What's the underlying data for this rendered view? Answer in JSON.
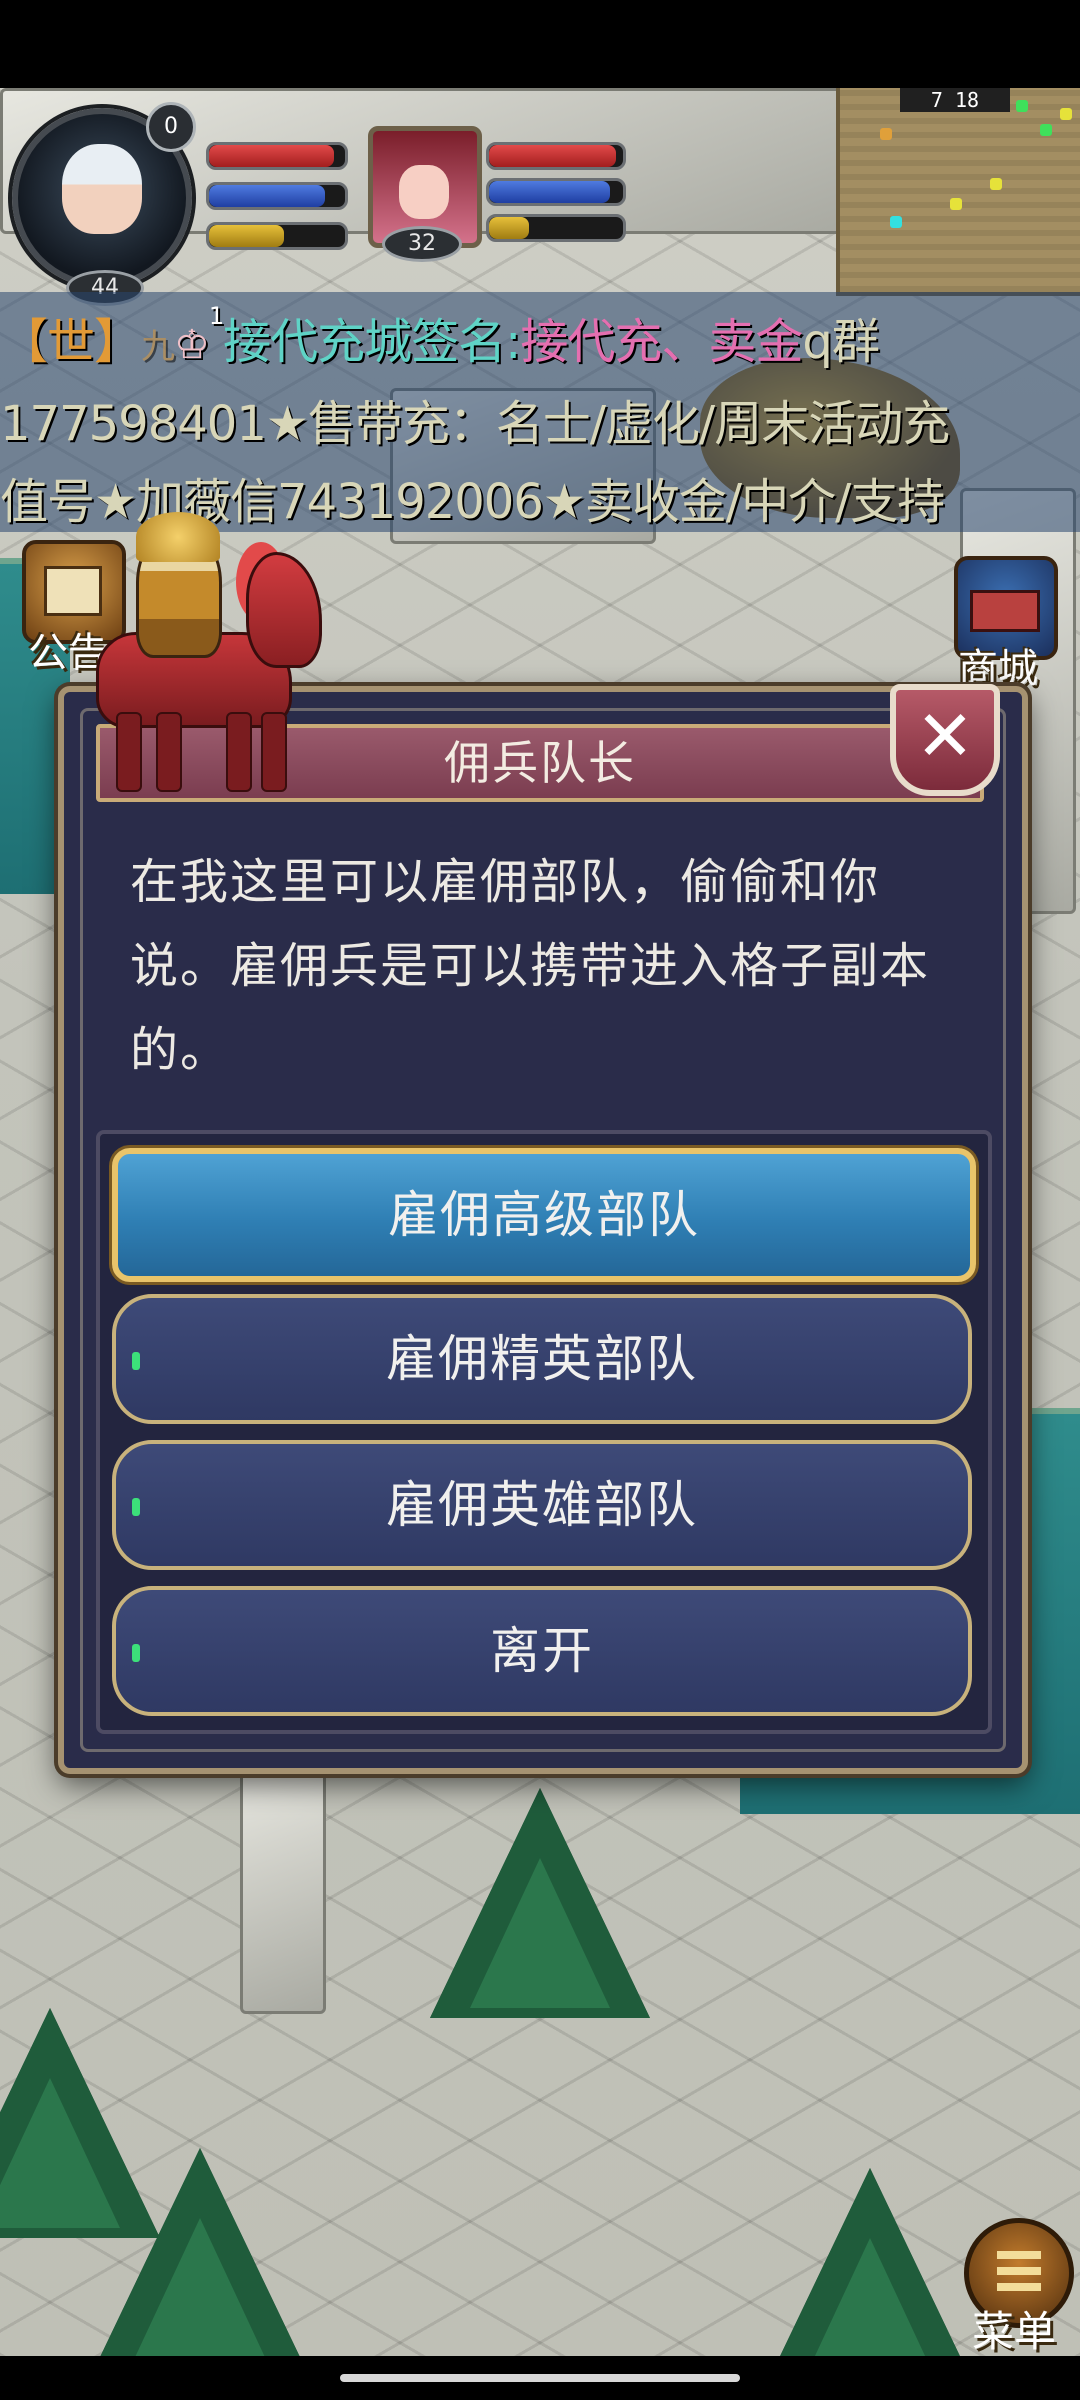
{
  "hud": {
    "player_notification_count": "0",
    "player_level": "44",
    "pet_level": "32",
    "minimap_coords": "7  18",
    "player_bars": {
      "hp": 0.92,
      "mp": 0.85,
      "xp": 0.55
    },
    "pet_bars": {
      "hp": 0.95,
      "mp": 0.9,
      "xp": 0.3
    }
  },
  "chat": {
    "channel_tag": "【世】",
    "sender_prefix": "九",
    "crown_level": "1",
    "line1_sender": "接代充城签名:",
    "line1_highlight": "接代充、卖金",
    "line1_tail": "q群",
    "line2": "177598401★售带充：名士/虚化/周末活动充",
    "line3": "值号★加薇信743192006★卖收金/中介/支持"
  },
  "side_buttons": {
    "announcement": "公告",
    "shop": "商城"
  },
  "dialog": {
    "title": "佣兵队长",
    "body": "在我这里可以雇佣部队，偷偷和你说。雇佣兵是可以携带进入格子副本的。",
    "close_icon": "close-icon",
    "options": [
      {
        "label": "雇佣高级部队",
        "selected": true
      },
      {
        "label": "雇佣精英部队",
        "selected": false
      },
      {
        "label": "雇佣英雄部队",
        "selected": false
      },
      {
        "label": "离开",
        "selected": false
      }
    ]
  },
  "bottom": {
    "menu_label": "菜单"
  },
  "colors": {
    "dialog_bg": "#2a2c4a",
    "dialog_border": "#a69271",
    "title_bar": "#8a4a5e",
    "option_selected": "#2f7fb4",
    "option_normal": "#343f6b",
    "chat_name": "#5fd3c6",
    "chat_highlight": "#e46fb0",
    "chat_world_tag": "#e29a36"
  }
}
